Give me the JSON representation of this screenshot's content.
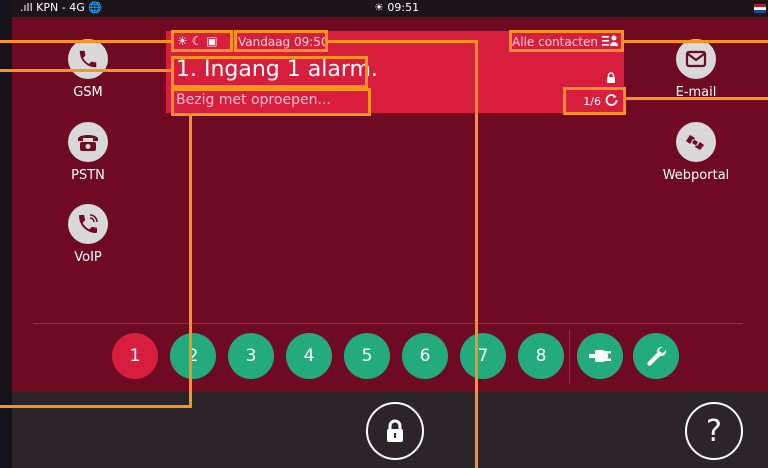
{
  "status_bar": {
    "carrier": "KPN - 4G",
    "time": "09:51"
  },
  "side_left": [
    {
      "label": "GSM",
      "icon": "phone-icon"
    },
    {
      "label": "PSTN",
      "icon": "landline-phone-icon"
    },
    {
      "label": "VoIP",
      "icon": "voip-phone-icon"
    }
  ],
  "side_right": [
    {
      "label": "E-mail",
      "icon": "mail-icon"
    },
    {
      "label": "Webportal",
      "icon": "webportal-icon"
    }
  ],
  "alarm_card": {
    "date_label": "Vandaag 09:50",
    "contacts_label": "Alle contacten",
    "title": "1. Ingang 1 alarm.",
    "subtitle": "Bezig met oproepen...",
    "counter": "1/6"
  },
  "number_buttons": [
    {
      "label": "1",
      "state": "alarm"
    },
    {
      "label": "2",
      "state": "normal"
    },
    {
      "label": "3",
      "state": "normal"
    },
    {
      "label": "4",
      "state": "normal"
    },
    {
      "label": "5",
      "state": "normal"
    },
    {
      "label": "6",
      "state": "normal"
    },
    {
      "label": "7",
      "state": "normal"
    },
    {
      "label": "8",
      "state": "normal"
    }
  ],
  "bottom_bar": {
    "help_label": "?"
  },
  "colors": {
    "panel": "#6e0b23",
    "card": "#d71e3c",
    "green": "#23ab7e",
    "annotation": "#f7941d"
  }
}
